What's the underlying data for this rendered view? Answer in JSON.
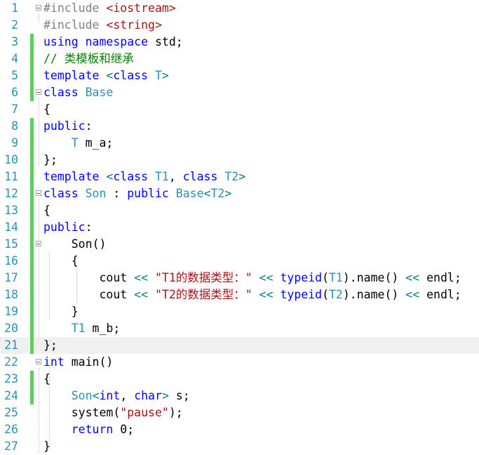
{
  "editor": {
    "lines": [
      {
        "n": "1",
        "fold": true,
        "bar": false,
        "tokens": [
          [
            "pp",
            "#include "
          ],
          [
            "str",
            "<iostream>"
          ]
        ]
      },
      {
        "n": "2",
        "fold": false,
        "bar": false,
        "tokens": [
          [
            "pp",
            "#include "
          ],
          [
            "str",
            "<string>"
          ]
        ]
      },
      {
        "n": "3",
        "fold": false,
        "bar": true,
        "tokens": [
          [
            "kw",
            "using namespace "
          ],
          [
            "pl",
            "std;"
          ]
        ]
      },
      {
        "n": "4",
        "fold": false,
        "bar": true,
        "tokens": [
          [
            "cmt",
            "// 类模板和继承"
          ]
        ]
      },
      {
        "n": "5",
        "fold": false,
        "bar": true,
        "tokens": [
          [
            "kw",
            "template "
          ],
          [
            "op",
            "<"
          ],
          [
            "kw",
            "class "
          ],
          [
            "type",
            "T"
          ],
          [
            "op",
            ">"
          ]
        ]
      },
      {
        "n": "6",
        "fold": true,
        "bar": true,
        "tokens": [
          [
            "kw",
            "class "
          ],
          [
            "type",
            "Base"
          ]
        ]
      },
      {
        "n": "7",
        "fold": false,
        "bar": false,
        "tokens": [
          [
            "pl",
            "{"
          ]
        ]
      },
      {
        "n": "8",
        "fold": false,
        "bar": true,
        "tokens": [
          [
            "kw",
            "public"
          ],
          [
            "pl",
            ":"
          ]
        ]
      },
      {
        "n": "9",
        "fold": false,
        "bar": true,
        "tokens": [
          [
            "pl",
            "    "
          ],
          [
            "type",
            "T"
          ],
          [
            "pl",
            " m_a;"
          ]
        ]
      },
      {
        "n": "10",
        "fold": false,
        "bar": true,
        "tokens": [
          [
            "pl",
            "};"
          ]
        ]
      },
      {
        "n": "11",
        "fold": false,
        "bar": true,
        "tokens": [
          [
            "kw",
            "template "
          ],
          [
            "op",
            "<"
          ],
          [
            "kw",
            "class "
          ],
          [
            "type",
            "T1"
          ],
          [
            "pl",
            ", "
          ],
          [
            "kw",
            "class "
          ],
          [
            "type",
            "T2"
          ],
          [
            "op",
            ">"
          ]
        ]
      },
      {
        "n": "12",
        "fold": true,
        "bar": true,
        "tokens": [
          [
            "kw",
            "class "
          ],
          [
            "type",
            "Son"
          ],
          [
            "pl",
            " : "
          ],
          [
            "kw",
            "public "
          ],
          [
            "type",
            "Base"
          ],
          [
            "op",
            "<"
          ],
          [
            "type",
            "T2"
          ],
          [
            "op",
            ">"
          ]
        ]
      },
      {
        "n": "13",
        "fold": false,
        "bar": true,
        "tokens": [
          [
            "pl",
            "{"
          ]
        ]
      },
      {
        "n": "14",
        "fold": false,
        "bar": true,
        "tokens": [
          [
            "kw",
            "public"
          ],
          [
            "pl",
            ":"
          ]
        ]
      },
      {
        "n": "15",
        "fold": true,
        "bar": true,
        "tokens": [
          [
            "pl",
            "    "
          ],
          [
            "fn",
            "Son"
          ],
          [
            "pl",
            "()"
          ]
        ]
      },
      {
        "n": "16",
        "fold": false,
        "bar": true,
        "tokens": [
          [
            "pl",
            "    {"
          ]
        ]
      },
      {
        "n": "17",
        "fold": false,
        "bar": true,
        "tokens": [
          [
            "pl",
            "        cout "
          ],
          [
            "op",
            "<<"
          ],
          [
            "pl",
            " "
          ],
          [
            "str",
            "\"T1的数据类型：\""
          ],
          [
            "pl",
            " "
          ],
          [
            "op",
            "<<"
          ],
          [
            "pl",
            " "
          ],
          [
            "kw",
            "typeid"
          ],
          [
            "pl",
            "("
          ],
          [
            "type",
            "T1"
          ],
          [
            "pl",
            ").name() "
          ],
          [
            "op",
            "<<"
          ],
          [
            "pl",
            " endl;"
          ]
        ]
      },
      {
        "n": "18",
        "fold": false,
        "bar": true,
        "tokens": [
          [
            "pl",
            "        cout "
          ],
          [
            "op",
            "<<"
          ],
          [
            "pl",
            " "
          ],
          [
            "str",
            "\"T2的数据类型：\""
          ],
          [
            "pl",
            " "
          ],
          [
            "op",
            "<<"
          ],
          [
            "pl",
            " "
          ],
          [
            "kw",
            "typeid"
          ],
          [
            "pl",
            "("
          ],
          [
            "type",
            "T2"
          ],
          [
            "pl",
            ").name() "
          ],
          [
            "op",
            "<<"
          ],
          [
            "pl",
            " endl;"
          ]
        ]
      },
      {
        "n": "19",
        "fold": false,
        "bar": true,
        "tokens": [
          [
            "pl",
            "    }"
          ]
        ]
      },
      {
        "n": "20",
        "fold": false,
        "bar": true,
        "tokens": [
          [
            "pl",
            "    "
          ],
          [
            "type",
            "T1"
          ],
          [
            "pl",
            " m_b;"
          ]
        ]
      },
      {
        "n": "21",
        "fold": false,
        "bar": true,
        "tokens": [
          [
            "pl",
            "};"
          ]
        ]
      },
      {
        "n": "22",
        "fold": true,
        "bar": false,
        "tokens": [
          [
            "kw",
            "int "
          ],
          [
            "fn",
            "main"
          ],
          [
            "pl",
            "()"
          ]
        ]
      },
      {
        "n": "23",
        "fold": false,
        "bar": true,
        "tokens": [
          [
            "pl",
            "{"
          ]
        ]
      },
      {
        "n": "24",
        "fold": false,
        "bar": true,
        "tokens": [
          [
            "pl",
            "    "
          ],
          [
            "type",
            "Son"
          ],
          [
            "op",
            "<"
          ],
          [
            "kw",
            "int"
          ],
          [
            "pl",
            ", "
          ],
          [
            "kw",
            "char"
          ],
          [
            "op",
            ">"
          ],
          [
            "pl",
            " s;"
          ]
        ]
      },
      {
        "n": "25",
        "fold": false,
        "bar": false,
        "tokens": [
          [
            "pl",
            "    system("
          ],
          [
            "str",
            "\"pause\""
          ],
          [
            "pl",
            ");"
          ]
        ]
      },
      {
        "n": "26",
        "fold": false,
        "bar": false,
        "tokens": [
          [
            "pl",
            "    "
          ],
          [
            "kw",
            "return "
          ],
          [
            "pl",
            "0;"
          ]
        ]
      },
      {
        "n": "27",
        "fold": false,
        "bar": false,
        "tokens": [
          [
            "pl",
            "}"
          ]
        ]
      }
    ]
  }
}
